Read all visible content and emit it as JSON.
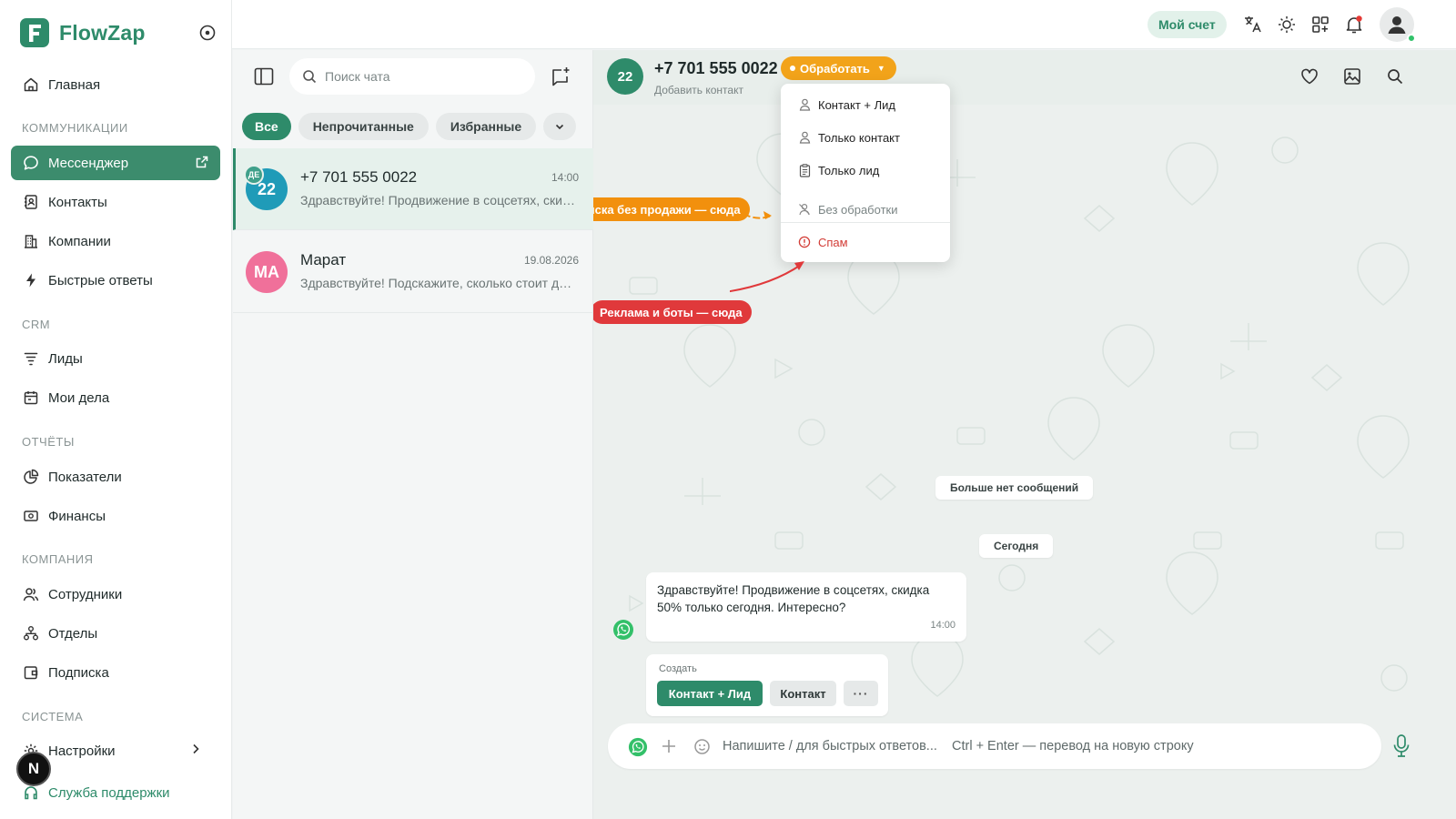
{
  "app": {
    "name": "FlowZap"
  },
  "sidebar": {
    "home": "Главная",
    "sections": {
      "communications": "КОММУНИКАЦИИ",
      "crm": "CRM",
      "reports": "ОТЧЁТЫ",
      "company": "КОМПАНИЯ",
      "system": "СИСТЕМА"
    },
    "items": {
      "messenger": "Мессенджер",
      "contacts": "Контакты",
      "companies": "Компании",
      "quick_replies": "Быстрые ответы",
      "leads": "Лиды",
      "tasks": "Мои дела",
      "metrics": "Показатели",
      "finance": "Финансы",
      "employees": "Сотрудники",
      "departments": "Отделы",
      "subscription": "Подписка",
      "settings": "Настройки",
      "support": "Служба поддержки"
    },
    "user_initial": "N"
  },
  "topbar": {
    "account": "Мой счет"
  },
  "chatlist": {
    "search_placeholder": "Поиск чата",
    "filters": {
      "all": "Все",
      "unread": "Непрочитанные",
      "favorites": "Избранные"
    },
    "chats": [
      {
        "avatar": "22",
        "tag": "ДЕ",
        "name": "+7 701 555 0022",
        "time": "14:00",
        "preview": "Здравствуйте! Продвижение в соцсетях, скидка 50% только сегодня. Интересно?"
      },
      {
        "avatar": "МА",
        "name": "Марат",
        "time": "19.08.2026",
        "preview": "Здравствуйте! Подскажите, сколько стоит доставка?"
      }
    ]
  },
  "conversation": {
    "avatar": "22",
    "title": "+7 701 555 0022",
    "subtitle": "Добавить контакт",
    "process_label": "Обработать",
    "menu": {
      "contact_lead": "Контакт + Лид",
      "contact_only": "Только контакт",
      "lead_only": "Только лид",
      "no_processing": "Без обработки",
      "spam": "Спам"
    },
    "callouts": {
      "no_sale": "Переписка без продажи — сюда",
      "ads_bots": "Реклама и боты — сюда"
    },
    "no_more": "Больше нет сообщений",
    "today": "Сегодня",
    "message": {
      "text": "Здравствуйте! Продвижение в соцсетях, скидка 50% только сегодня. Интересно?",
      "time": "14:00"
    },
    "create": {
      "label": "Создать",
      "contact_lead": "Контакт + Лид",
      "contact": "Контакт",
      "more": "···"
    },
    "composer_placeholder": "Напишите / для быстрых ответов...    Ctrl + Enter — перевод на новую строку"
  },
  "colors": {
    "brand": "#2e8b6a",
    "process": "#f2a31a",
    "callout_orange": "#f2900d",
    "callout_red": "#e0393b",
    "marat_avatar": "#f0709a",
    "chat_avatar": "#1f9bb8"
  },
  "icons": [
    "home-icon",
    "chat-icon",
    "external-link-icon",
    "contacts-icon",
    "building-icon",
    "bolt-icon",
    "funnel-icon",
    "calendar-icon",
    "pie-chart-icon",
    "money-icon",
    "users-icon",
    "departments-icon",
    "wallet-icon",
    "gear-icon",
    "headset-icon",
    "translate-icon",
    "sun-icon",
    "grid-icon",
    "bell-icon",
    "user-icon",
    "sidebar-toggle-icon",
    "search-icon",
    "new-chat-icon",
    "chevron-down-icon",
    "heart-icon",
    "image-icon",
    "whatsapp-icon",
    "plus-icon",
    "emoji-icon",
    "mic-icon"
  ]
}
